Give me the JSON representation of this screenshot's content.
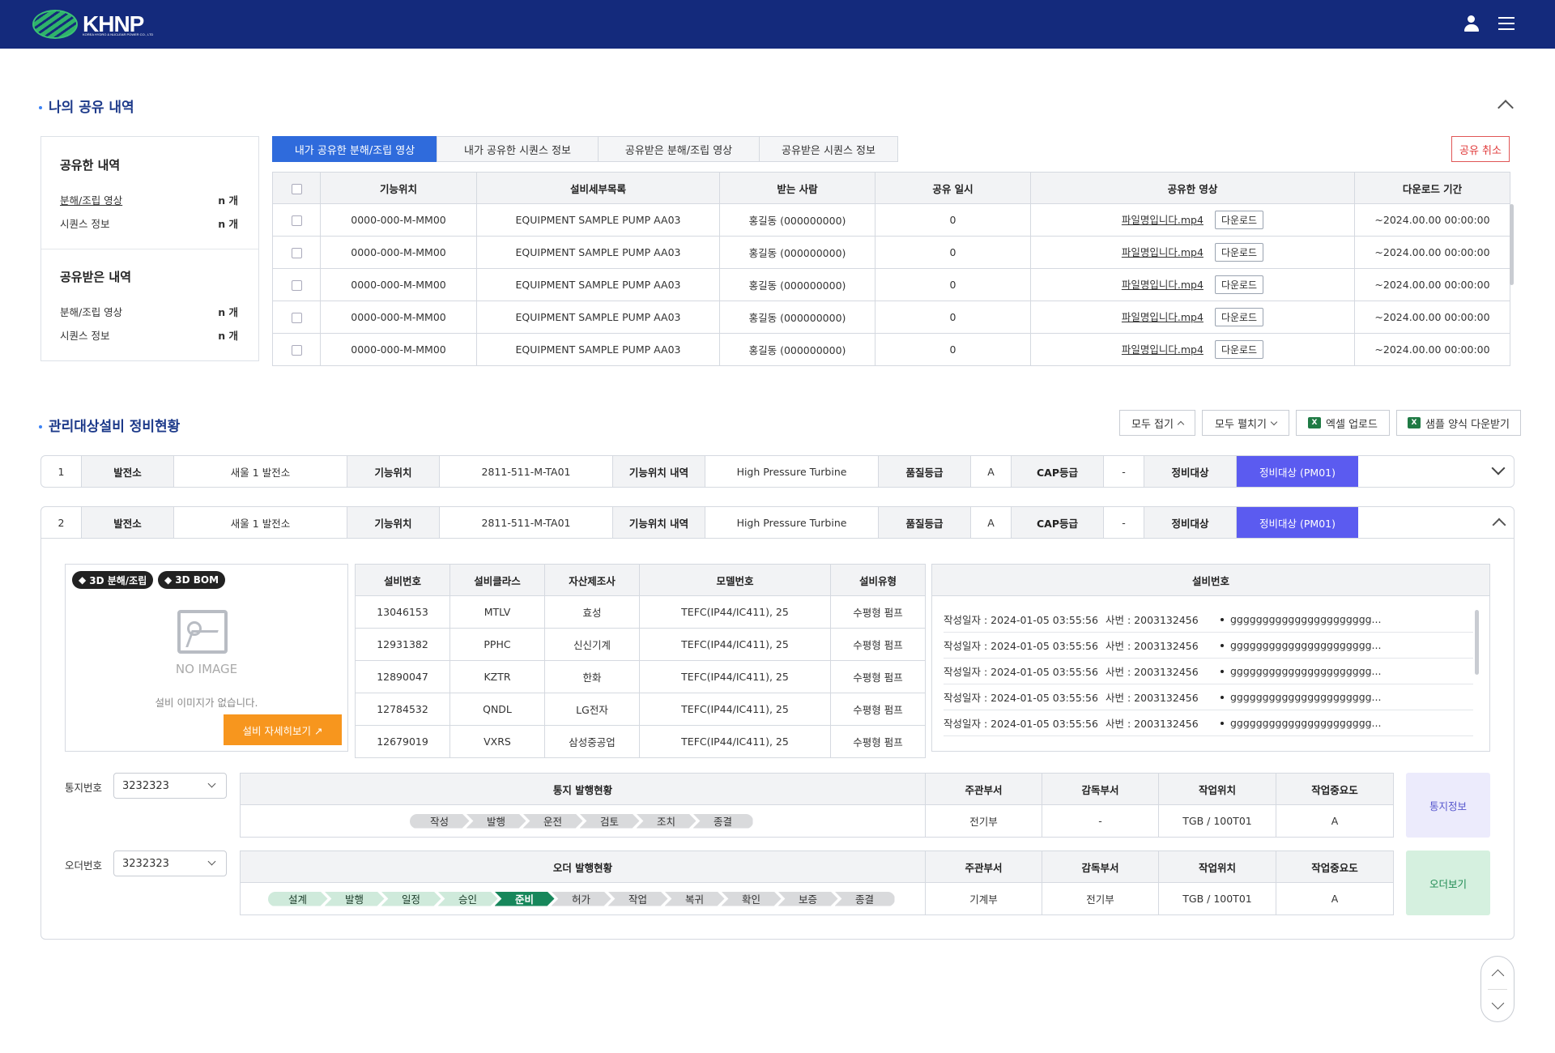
{
  "header": {
    "logo_text": "KHNP",
    "logo_sub": "KOREA HYDRO & NUCLEAR POWER CO., LTD"
  },
  "share_section": {
    "title": "나의 공유 내역",
    "summary": {
      "shared_title": "공유한 내역",
      "shared_items": [
        {
          "label": "분해/조립 영상",
          "count": "n 개"
        },
        {
          "label": "시퀀스 정보",
          "count": "n 개"
        }
      ],
      "received_title": "공유받은 내역",
      "received_items": [
        {
          "label": "분해/조립 영상",
          "count": "n 개"
        },
        {
          "label": "시퀀스 정보",
          "count": "n 개"
        }
      ]
    },
    "tabs": [
      "내가 공유한 분해/조립 영상",
      "내가 공유한 시퀀스 정보",
      "공유받은 분해/조립 영상",
      "공유받은 시퀀스 정보"
    ],
    "cancel_label": "공유 취소",
    "columns": [
      "기능위치",
      "설비세부목록",
      "받는 사람",
      "공유 일시",
      "공유한 영상",
      "다운로드 기간"
    ],
    "download_label": "다운로드",
    "rows": [
      {
        "loc": "0000-000-M-MM00",
        "equip": "EQUIPMENT SAMPLE PUMP AA03",
        "recv": "홍길동 (000000000)",
        "date": "0",
        "file": "파일명입니다.mp4",
        "period": "~2024.00.00 00:00:00"
      },
      {
        "loc": "0000-000-M-MM00",
        "equip": "EQUIPMENT SAMPLE PUMP AA03",
        "recv": "홍길동 (000000000)",
        "date": "0",
        "file": "파일명입니다.mp4",
        "period": "~2024.00.00 00:00:00"
      },
      {
        "loc": "0000-000-M-MM00",
        "equip": "EQUIPMENT SAMPLE PUMP AA03",
        "recv": "홍길동 (000000000)",
        "date": "0",
        "file": "파일명입니다.mp4",
        "period": "~2024.00.00 00:00:00"
      },
      {
        "loc": "0000-000-M-MM00",
        "equip": "EQUIPMENT SAMPLE PUMP AA03",
        "recv": "홍길동 (000000000)",
        "date": "0",
        "file": "파일명입니다.mp4",
        "period": "~2024.00.00 00:00:00"
      },
      {
        "loc": "0000-000-M-MM00",
        "equip": "EQUIPMENT SAMPLE PUMP AA03",
        "recv": "홍길동 (000000000)",
        "date": "0",
        "file": "파일명입니다.mp4",
        "period": "~2024.00.00 00:00:00"
      }
    ]
  },
  "maint_section": {
    "title": "관리대상설비 정비현황",
    "buttons": {
      "collapse_all": "모두 접기",
      "expand_all": "모두 펼치기",
      "excel_upload": "엑셀 업로드",
      "sample_download": "샘플 양식 다운받기"
    },
    "equip_rows": [
      {
        "no": "1",
        "k1": "발전소",
        "v1": "새울 1 발전소",
        "k2": "기능위치",
        "v2": "2811-511-M-TA01",
        "k3": "기능위치 내역",
        "v3": "High Pressure Turbine",
        "k4": "품질등급",
        "v4": "A",
        "k5": "CAP등급",
        "v5": "-",
        "k6": "정비대상",
        "v6": "정비대상 (PM01)"
      },
      {
        "no": "2",
        "k1": "발전소",
        "v1": "새울 1 발전소",
        "k2": "기능위치",
        "v2": "2811-511-M-TA01",
        "k3": "기능위치 내역",
        "v3": "High Pressure Turbine",
        "k4": "품질등급",
        "v4": "A",
        "k5": "CAP등급",
        "v5": "-",
        "k6": "정비대상",
        "v6": "정비대상 (PM01)"
      }
    ],
    "detail": {
      "tags": [
        "3D 분해/조립",
        "3D BOM"
      ],
      "no_image": "NO IMAGE",
      "no_image_desc": "설비 이미지가 없습니다.",
      "detail_button": "설비 자세히보기 ↗",
      "eq_columns": [
        "설비번호",
        "설비클라스",
        "자산제조사",
        "모델번호",
        "설비유형"
      ],
      "eq_rows": [
        {
          "no": "13046153",
          "cls": "MTLV",
          "mfr": "효성",
          "model": "TEFC(IP44/IC411), 25",
          "type": "수평형 펌프"
        },
        {
          "no": "12931382",
          "cls": "PPHC",
          "mfr": "신신기계",
          "model": "TEFC(IP44/IC411), 25",
          "type": "수평형 펌프"
        },
        {
          "no": "12890047",
          "cls": "KZTR",
          "mfr": "한화",
          "model": "TEFC(IP44/IC411), 25",
          "type": "수평형 펌프"
        },
        {
          "no": "12784532",
          "cls": "QNDL",
          "mfr": "LG전자",
          "model": "TEFC(IP44/IC411), 25",
          "type": "수평형 펌프"
        },
        {
          "no": "12679019",
          "cls": "VXRS",
          "mfr": "삼성중공업",
          "model": "TEFC(IP44/IC411), 25",
          "type": "수평형 펌프"
        }
      ],
      "memo_title": "설비번호",
      "memo_rows": [
        {
          "date": "작성일자 : 2024-01-05 03:55:56",
          "emp": "사번 : 2003132456",
          "text": "gggggggggggggggggggggg..."
        },
        {
          "date": "작성일자 : 2024-01-05 03:55:56",
          "emp": "사번 : 2003132456",
          "text": "gggggggggggggggggggggg..."
        },
        {
          "date": "작성일자 : 2024-01-05 03:55:56",
          "emp": "사번 : 2003132456",
          "text": "gggggggggggggggggggggg..."
        },
        {
          "date": "작성일자 : 2024-01-05 03:55:56",
          "emp": "사번 : 2003132456",
          "text": "gggggggggggggggggggggg..."
        },
        {
          "date": "작성일자 : 2024-01-05 03:55:56",
          "emp": "사번 : 2003132456",
          "text": "gggggggggggggggggggggg..."
        }
      ],
      "notice": {
        "label": "통지번호",
        "value": "3232323",
        "status_title": "통지 발행현황",
        "cols": [
          "주관부서",
          "감독부서",
          "작업위치",
          "작업중요도"
        ],
        "vals": [
          "전기부",
          "-",
          "TGB / 100T01",
          "A"
        ],
        "steps": [
          "작성",
          "발행",
          "운전",
          "검토",
          "조치",
          "종결"
        ],
        "button": "통지정보"
      },
      "order": {
        "label": "오더번호",
        "value": "3232323",
        "status_title": "오더 발행현황",
        "cols": [
          "주관부서",
          "감독부서",
          "작업위치",
          "작업중요도"
        ],
        "vals": [
          "기계부",
          "전기부",
          "TGB / 100T01",
          "A"
        ],
        "steps": [
          "설계",
          "발행",
          "일정",
          "승인",
          "준비",
          "허가",
          "작업",
          "복귀",
          "확인",
          "보증",
          "종결"
        ],
        "button": "오더보기"
      }
    }
  }
}
